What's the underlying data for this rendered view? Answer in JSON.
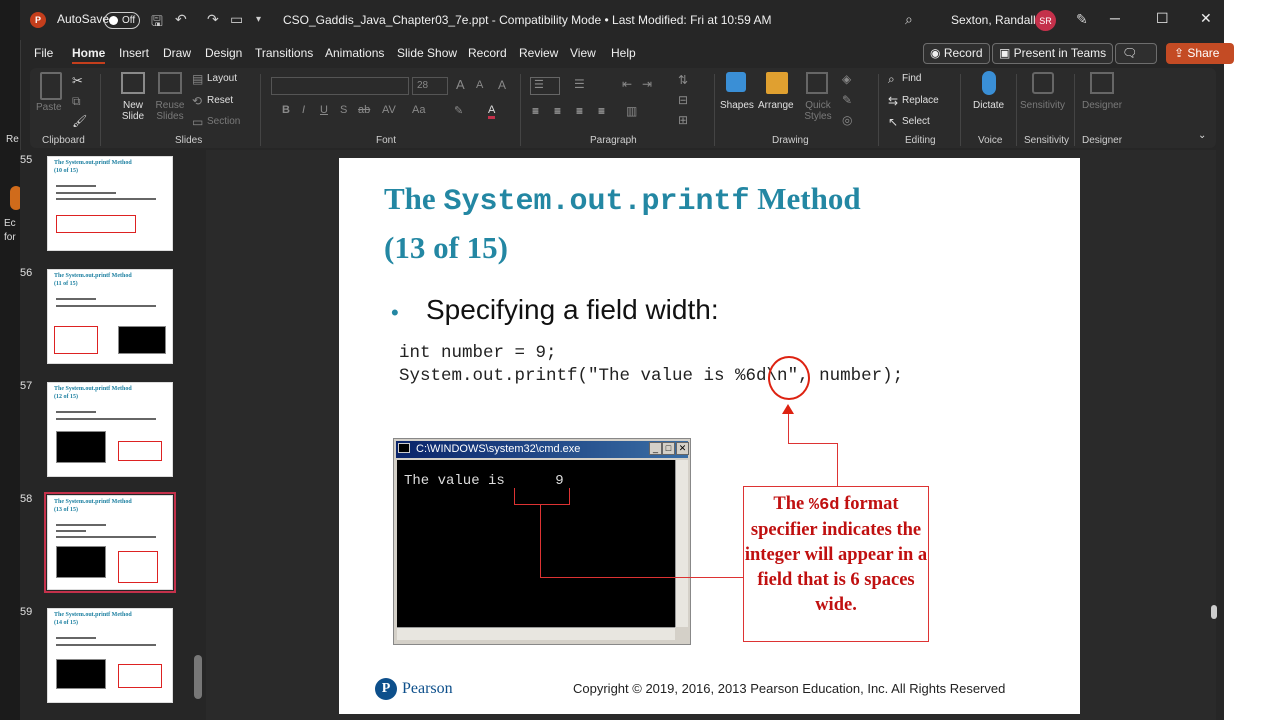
{
  "behind": {
    "text1": "Re",
    "text2": "Ec",
    "text3": "for"
  },
  "titlebar": {
    "app_logo": "P",
    "autosave_label": "AutoSave",
    "autosave_state": "Off",
    "document_title": "CSO_Gaddis_Java_Chapter03_7e.ppt  -  Compatibility Mode  •  Last Modified: Fri at 10:59 AM",
    "user_name": "Sexton, Randall S",
    "user_initials": "SR"
  },
  "menu": {
    "items": [
      "File",
      "Home",
      "Insert",
      "Draw",
      "Design",
      "Transitions",
      "Animations",
      "Slide Show",
      "Record",
      "Review",
      "View",
      "Help"
    ],
    "active": "Home",
    "record_btn": "Record",
    "present_btn": "Present in Teams",
    "share_btn": "Share"
  },
  "ribbon": {
    "groups": [
      "Clipboard",
      "Slides",
      "Font",
      "Paragraph",
      "Drawing",
      "Editing",
      "Voice",
      "Sensitivity",
      "Designer"
    ],
    "paste": "Paste",
    "new_slide": "New Slide",
    "reuse_slides": "Reuse Slides",
    "layout": "Layout",
    "reset": "Reset",
    "section": "Section",
    "font_size": "28",
    "shapes": "Shapes",
    "arrange": "Arrange",
    "quick_styles": "Quick Styles",
    "find": "Find",
    "replace": "Replace",
    "select": "Select",
    "dictate": "Dictate",
    "sensitivity": "Sensitivity",
    "designer": "Designer"
  },
  "thumbnails": [
    {
      "number": "55",
      "title_line1": "The System.out.printf Method",
      "title_line2": "(10 of 15)"
    },
    {
      "number": "56",
      "title_line1": "The System.out.printf Method",
      "title_line2": "(11 of 15)"
    },
    {
      "number": "57",
      "title_line1": "The System.out.printf Method",
      "title_line2": "(12 of 15)"
    },
    {
      "number": "58",
      "title_line1": "The System.out.printf Method",
      "title_line2": "(13 of 15)",
      "selected": true
    },
    {
      "number": "59",
      "title_line1": "The System.out.printf Method",
      "title_line2": "(14 of 15)"
    }
  ],
  "slide": {
    "title_word1": "The ",
    "title_code": "System.out.printf",
    "title_word2": " Method",
    "title_line2": "(13 of 15)",
    "bullet": "Specifying a field width:",
    "code_line1": "int number = 9;",
    "code_line2": "System.out.printf(\"The value is %6d\\n\", number);",
    "cmd_title": "C:\\WINDOWS\\system32\\cmd.exe",
    "cmd_output": "The value is      9",
    "callout_pre": "The ",
    "callout_code": "%6d",
    "callout_post": " format specifier indicates the integer will appear in a field that is 6 spaces wide.",
    "footer_logo": "Pearson",
    "copyright": "Copyright © 2019, 2016, 2013 Pearson Education, Inc. All Rights Reserved"
  },
  "colors": {
    "accent": "#c43e1c",
    "title_teal": "#2387a3",
    "callout_red": "#c01010"
  }
}
